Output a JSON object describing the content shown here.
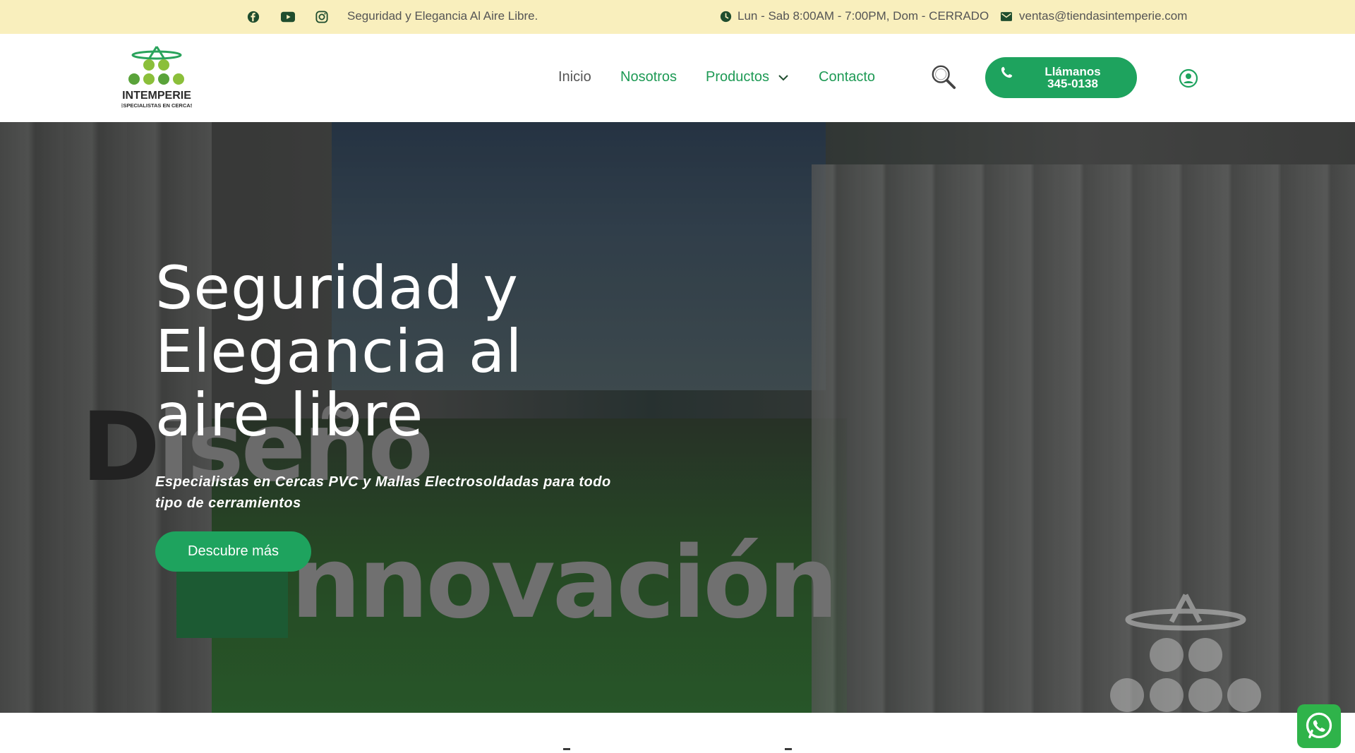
{
  "topbar": {
    "tagline": "Seguridad y Elegancia Al Aire Libre.",
    "hours": "Lun - Sab 8:00AM - 7:00PM, Dom - CERRADO",
    "email": "ventas@tiendasintemperie.com",
    "social_icons": [
      "facebook-icon",
      "youtube-icon",
      "instagram-icon"
    ]
  },
  "header": {
    "logo_text": "INTEMPERIE",
    "logo_subtext": "ESPECIALISTAS EN CERCAS",
    "nav": [
      {
        "label": "Inicio",
        "active": false
      },
      {
        "label": "Nosotros",
        "active": true
      },
      {
        "label": "Productos",
        "active": true,
        "has_dropdown": true
      },
      {
        "label": "Contacto",
        "active": true
      }
    ],
    "call_line1": "Llámanos",
    "call_line2": "345-0138"
  },
  "hero": {
    "title": "Seguridad y Elegancia al aire libre",
    "subtitle": "Especialistas en Cercas PVC y Mallas Electrosoldadas para todo tipo de cerramientos",
    "cta": "Descubre más",
    "bg_word1_first": "D",
    "bg_word1_rest": "iseño",
    "bg_word2_rest": "nnovación"
  },
  "colors": {
    "accent": "#1ea35e",
    "topbar_bg": "#f9efbd",
    "nav_green": "#1e9a55"
  }
}
